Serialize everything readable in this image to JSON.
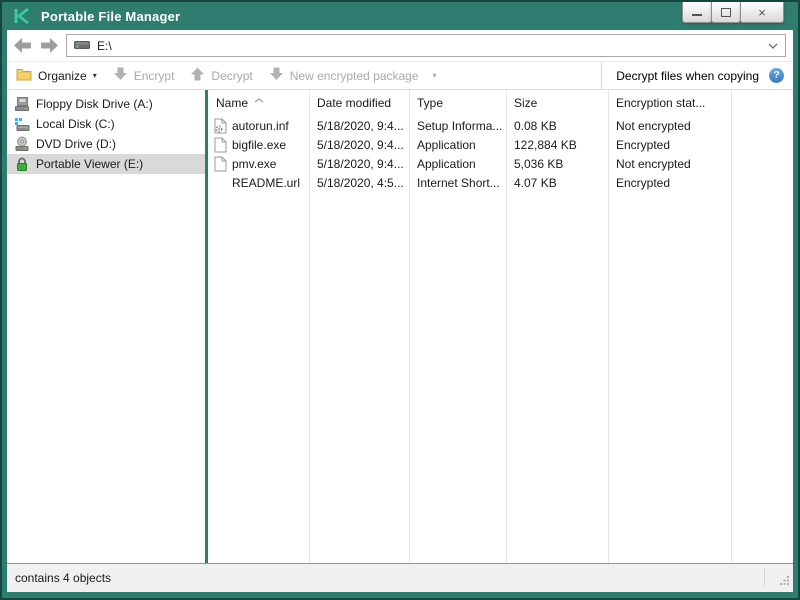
{
  "colors": {
    "titlebar_teal": "#2E7D6E",
    "border_dark_teal": "#16473C",
    "logo_green": "#3CC6A1",
    "selection_gray": "#D9D9D9",
    "help_blue": "#3A79BF",
    "folder_yellow": "#F6D26A",
    "disabled_text": "#A9A9A9",
    "lock_green": "#3FAE3F"
  },
  "icons": {
    "kaspersky-logo-icon": "K",
    "minimize-icon": "–",
    "maximize-icon": "□",
    "close-icon": "×",
    "back-icon": "left-arrow",
    "forward-icon": "right-arrow",
    "drive-icon": "drive",
    "chevron-down-icon": "v",
    "folder-icon": "folder",
    "encrypt-icon": "down-arrow",
    "decrypt-icon": "up-arrow",
    "package-icon": "down-arrow",
    "help-icon": "?",
    "dropdown-caret": "▾",
    "sort-asc-icon": "^"
  },
  "titlebar": {
    "title": "Portable File Manager",
    "close_glyph": "×"
  },
  "navbar": {
    "address": "E:\\"
  },
  "toolbar": {
    "organize": "Organize",
    "encrypt": "Encrypt",
    "decrypt": "Decrypt",
    "new_package": "New encrypted package",
    "decrypt_when_copying": "Decrypt files when copying",
    "caret": "▾"
  },
  "sidebar": {
    "items": [
      {
        "label": "Floppy Disk Drive (A:)",
        "icon": "floppy-drive-icon",
        "selected": false
      },
      {
        "label": "Local Disk (C:)",
        "icon": "hard-disk-icon",
        "selected": false
      },
      {
        "label": "DVD Drive (D:)",
        "icon": "dvd-drive-icon",
        "selected": false
      },
      {
        "label": "Portable Viewer (E:)",
        "icon": "lock-icon",
        "selected": true
      }
    ]
  },
  "filelist": {
    "columns": [
      "Name",
      "Date modified",
      "Type",
      "Size",
      "Encryption stat..."
    ],
    "rows": [
      {
        "name": "autorun.inf",
        "date": "5/18/2020, 9:4...",
        "type": "Setup Informa...",
        "size": "0.08 KB",
        "status": "Not encrypted",
        "icon": "setup-file-icon"
      },
      {
        "name": "bigfile.exe",
        "date": "5/18/2020, 9:4...",
        "type": "Application",
        "size": "122,884 KB",
        "status": "Encrypted",
        "icon": "file-icon"
      },
      {
        "name": "pmv.exe",
        "date": "5/18/2020, 9:4...",
        "type": "Application",
        "size": "5,036 KB",
        "status": "Not encrypted",
        "icon": "file-icon"
      },
      {
        "name": "README.url",
        "date": "5/18/2020, 4:5...",
        "type": "Internet Short...",
        "size": "4.07 KB",
        "status": "Encrypted",
        "icon": "none"
      }
    ]
  },
  "statusbar": {
    "text": "contains 4 objects"
  }
}
